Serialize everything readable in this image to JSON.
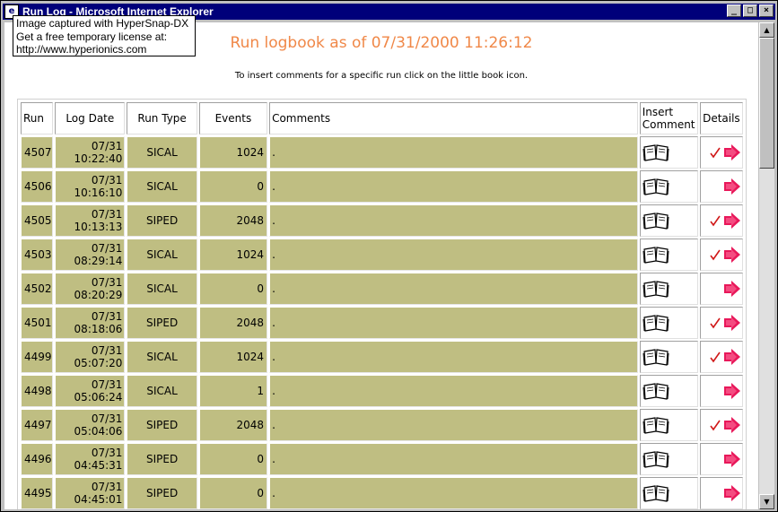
{
  "window": {
    "title": "Run Log - Microsoft Internet Explorer",
    "controls": {
      "minimize": "_",
      "maximize": "□",
      "close": "×"
    }
  },
  "snap_overlay": {
    "line1": "Image captured with HyperSnap-DX",
    "line2": "Get a free temporary license at:",
    "line3": "http://www.hyperionics.com"
  },
  "page": {
    "title": "Run logbook as of 07/31/2000 11:26:12",
    "subtitle": "To insert comments for a specific run click on the little book icon."
  },
  "table": {
    "headers": {
      "run": "Run",
      "log_date": "Log Date",
      "run_type": "Run Type",
      "events": "Events",
      "comments": "Comments",
      "insert_comment": "Insert Comment",
      "details": "Details"
    },
    "rows": [
      {
        "run": "4507",
        "date": "07/31",
        "time": "10:22:40",
        "type": "SICAL",
        "events": "1024",
        "comment": ".",
        "checked": true
      },
      {
        "run": "4506",
        "date": "07/31",
        "time": "10:16:10",
        "type": "SICAL",
        "events": "0",
        "comment": ".",
        "checked": false
      },
      {
        "run": "4505",
        "date": "07/31",
        "time": "10:13:13",
        "type": "SIPED",
        "events": "2048",
        "comment": ".",
        "checked": true
      },
      {
        "run": "4503",
        "date": "07/31",
        "time": "08:29:14",
        "type": "SICAL",
        "events": "1024",
        "comment": ".",
        "checked": true
      },
      {
        "run": "4502",
        "date": "07/31",
        "time": "08:20:29",
        "type": "SICAL",
        "events": "0",
        "comment": ".",
        "checked": false
      },
      {
        "run": "4501",
        "date": "07/31",
        "time": "08:18:06",
        "type": "SIPED",
        "events": "2048",
        "comment": ".",
        "checked": true
      },
      {
        "run": "4499",
        "date": "07/31",
        "time": "05:07:20",
        "type": "SICAL",
        "events": "1024",
        "comment": ".",
        "checked": true
      },
      {
        "run": "4498",
        "date": "07/31",
        "time": "05:06:24",
        "type": "SICAL",
        "events": "1",
        "comment": ".",
        "checked": false
      },
      {
        "run": "4497",
        "date": "07/31",
        "time": "05:04:06",
        "type": "SIPED",
        "events": "2048",
        "comment": ".",
        "checked": true
      },
      {
        "run": "4496",
        "date": "07/31",
        "time": "04:45:31",
        "type": "SIPED",
        "events": "0",
        "comment": ".",
        "checked": false
      },
      {
        "run": "4495",
        "date": "07/31",
        "time": "04:45:01",
        "type": "SIPED",
        "events": "0",
        "comment": ".",
        "checked": false
      }
    ]
  },
  "icons": {
    "insert_comment": "book-icon",
    "details_check": "checkmark-icon",
    "details_link": "arrow-right-icon"
  },
  "colors": {
    "title_orange": "#f08848",
    "cell_khaki": "#bfbe82",
    "check_red": "#d01818",
    "arrow_pink": "#e8185a",
    "titlebar_navy": "#00007a"
  }
}
